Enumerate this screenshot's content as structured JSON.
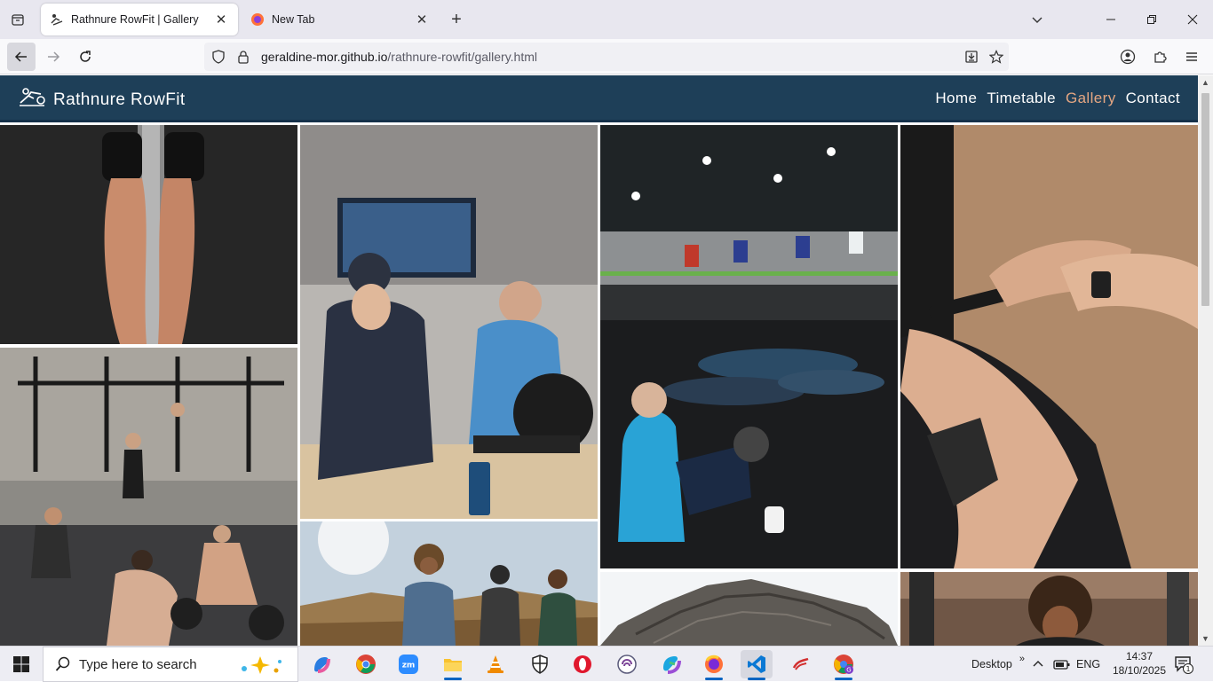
{
  "browser": {
    "tabs": [
      {
        "title": "Rathnure RowFit | Gallery",
        "active": true
      },
      {
        "title": "New Tab",
        "active": false
      }
    ],
    "url": {
      "host": "geraldine-mor.github.io",
      "path": "/rathnure-rowfit/gallery.html"
    }
  },
  "site": {
    "brand": "Rathnure RowFit",
    "nav": [
      {
        "label": "Home"
      },
      {
        "label": "Timetable"
      },
      {
        "label": "Gallery",
        "current": true
      },
      {
        "label": "Contact"
      }
    ],
    "accent_color": "#e4a682",
    "header_color": "#1e3f58"
  },
  "gallery": {
    "photos": [
      {
        "name": "rowing-legs-photo",
        "subject": "rower-legs"
      },
      {
        "name": "indoor-rowing-event-photo",
        "subject": "indoor-rowing-event"
      },
      {
        "name": "gym-situps-class-photo",
        "subject": "gym-class"
      },
      {
        "name": "rowing-handle-grip-photo",
        "subject": "rowing-handle"
      },
      {
        "name": "crossfit-group-photo",
        "subject": "crossfit-group"
      },
      {
        "name": "friends-hiking-photo",
        "subject": "hiking"
      },
      {
        "name": "rock-formation-photo",
        "subject": "rocks"
      },
      {
        "name": "woman-gym-workout-photo",
        "subject": "gym-woman"
      }
    ]
  },
  "taskbar": {
    "search_placeholder": "Type here to search",
    "desktop_label": "Desktop",
    "language": "ENG",
    "time": "14:37",
    "date": "18/10/2025",
    "notification_count": "1",
    "apps": [
      "file-explorer",
      "chrome",
      "zoom",
      "folder",
      "vlc",
      "security",
      "opera",
      "tor",
      "m365",
      "firefox",
      "vscode",
      "app-red",
      "chrome-profile"
    ]
  }
}
